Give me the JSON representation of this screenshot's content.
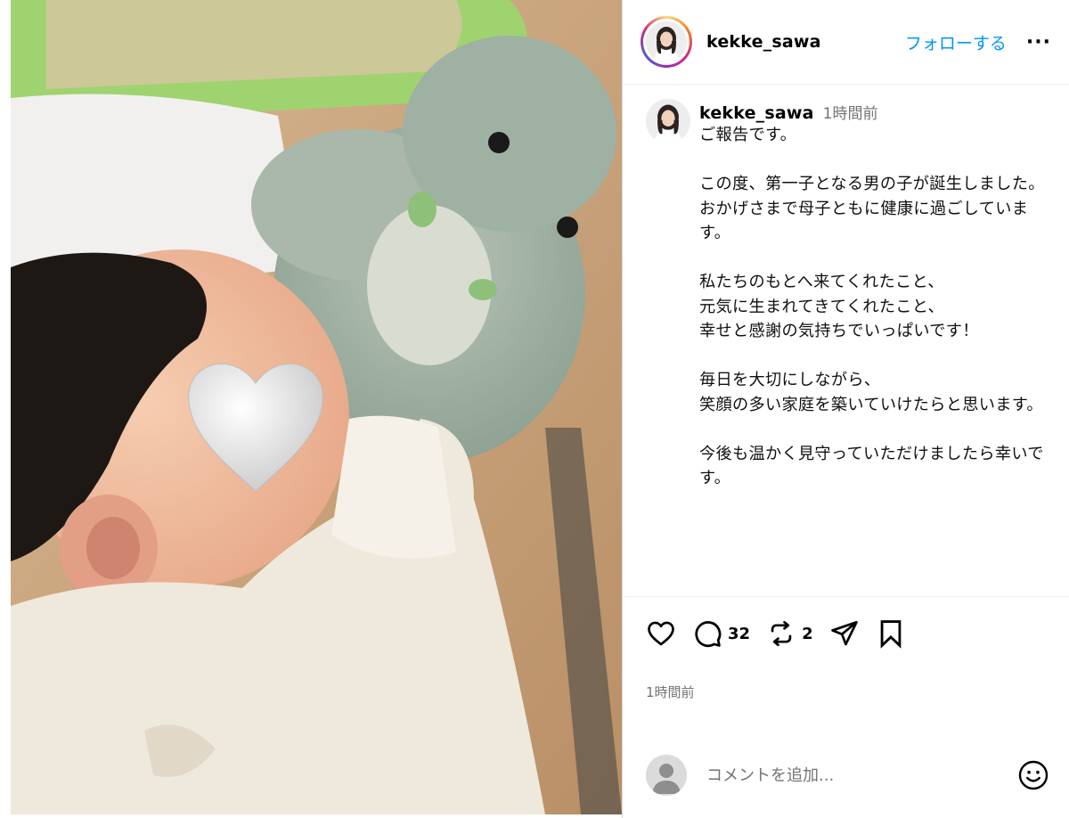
{
  "photo": {
    "description_icon": "baby-photo",
    "sticker_icon": "heart-icon"
  },
  "header": {
    "username": "kekke_sawa",
    "follow_label": "フォローする",
    "more_label": "···"
  },
  "caption": {
    "username": "kekke_sawa",
    "time": "1時間前",
    "text": "ご報告です。\n\nこの度、第一子となる男の子が誕生しました。\nおかげさまで母子ともに健康に過ごしています。\n\n私たちのもとへ来てくれたこと、\n元気に生まれてきてくれたこと、\n幸せと感謝の気持ちでいっぱいです！\n\n毎日を大切にしながら、\n笑顔の多い家庭を築いていけたらと思います。\n\n今後も温かく見守っていただけましたら幸いです。"
  },
  "actions": {
    "comment_count": "32",
    "repost_count": "2"
  },
  "post_time": "1時間前",
  "comment": {
    "placeholder": "コメントを追加..."
  },
  "colors": {
    "link": "#0095f6",
    "secondary_text": "#737373",
    "border": "#dbdbdb"
  }
}
